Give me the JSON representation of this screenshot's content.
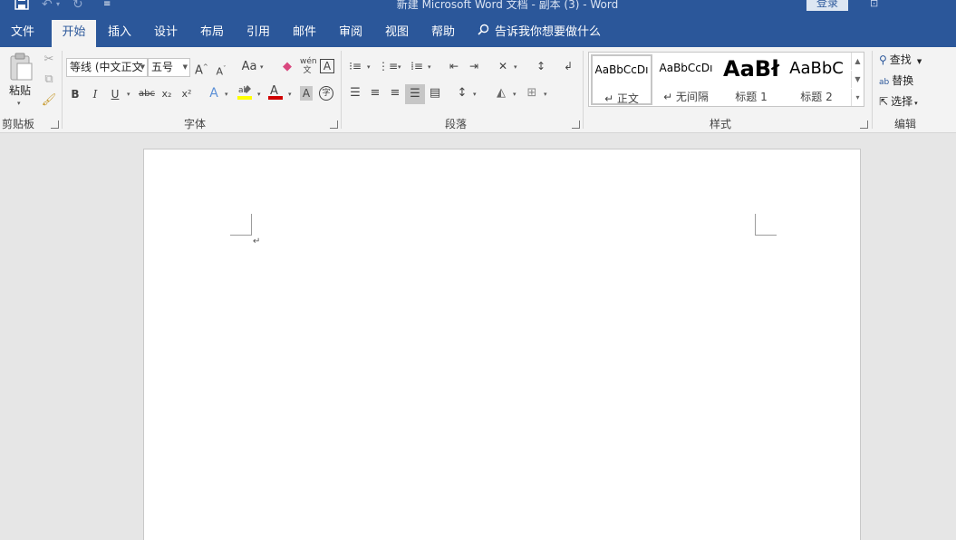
{
  "window": {
    "title": "新建 Microsoft Word 文档 - 副本 (3)  -  Word",
    "login_label": "登录"
  },
  "tabs": [
    "文件",
    "开始",
    "插入",
    "设计",
    "布局",
    "引用",
    "邮件",
    "审阅",
    "视图",
    "帮助"
  ],
  "active_tab": "开始",
  "tell_me": "告诉我你想要做什么",
  "clipboard": {
    "group_label": "剪贴板",
    "paste_label": "粘贴"
  },
  "font": {
    "group_label": "字体",
    "font_name": "等线 (中文正文",
    "font_size": "五号",
    "grow_label": "A",
    "shrink_label": "A",
    "case_label": "Aa",
    "bold": "B",
    "italic": "I",
    "underline": "U",
    "strike": "abc",
    "subscript": "x₂",
    "superscript": "x²",
    "phonetic_label": "wén",
    "border_char": "A",
    "enclose_char": "字",
    "highlight_color": "#ffff00",
    "font_color": "#d00000"
  },
  "paragraph": {
    "group_label": "段落"
  },
  "styles": {
    "group_label": "样式",
    "items": [
      {
        "sample": "AaBbCcDı",
        "name": "↵ 正文"
      },
      {
        "sample": "AaBbCcDı",
        "name": "↵ 无间隔"
      },
      {
        "sample": "AaBł",
        "name": "标题 1"
      },
      {
        "sample": "AaBbC",
        "name": "标题 2"
      }
    ]
  },
  "editing": {
    "group_label": "编辑",
    "find_label": "查找",
    "replace_label": "替换",
    "select_label": "选择"
  },
  "document": {
    "paragraph_mark": "↵"
  },
  "colors": {
    "title_bar": "#2b579a",
    "ribbon_bg": "#f3f3f3",
    "canvas_bg": "#e6e6e6"
  }
}
